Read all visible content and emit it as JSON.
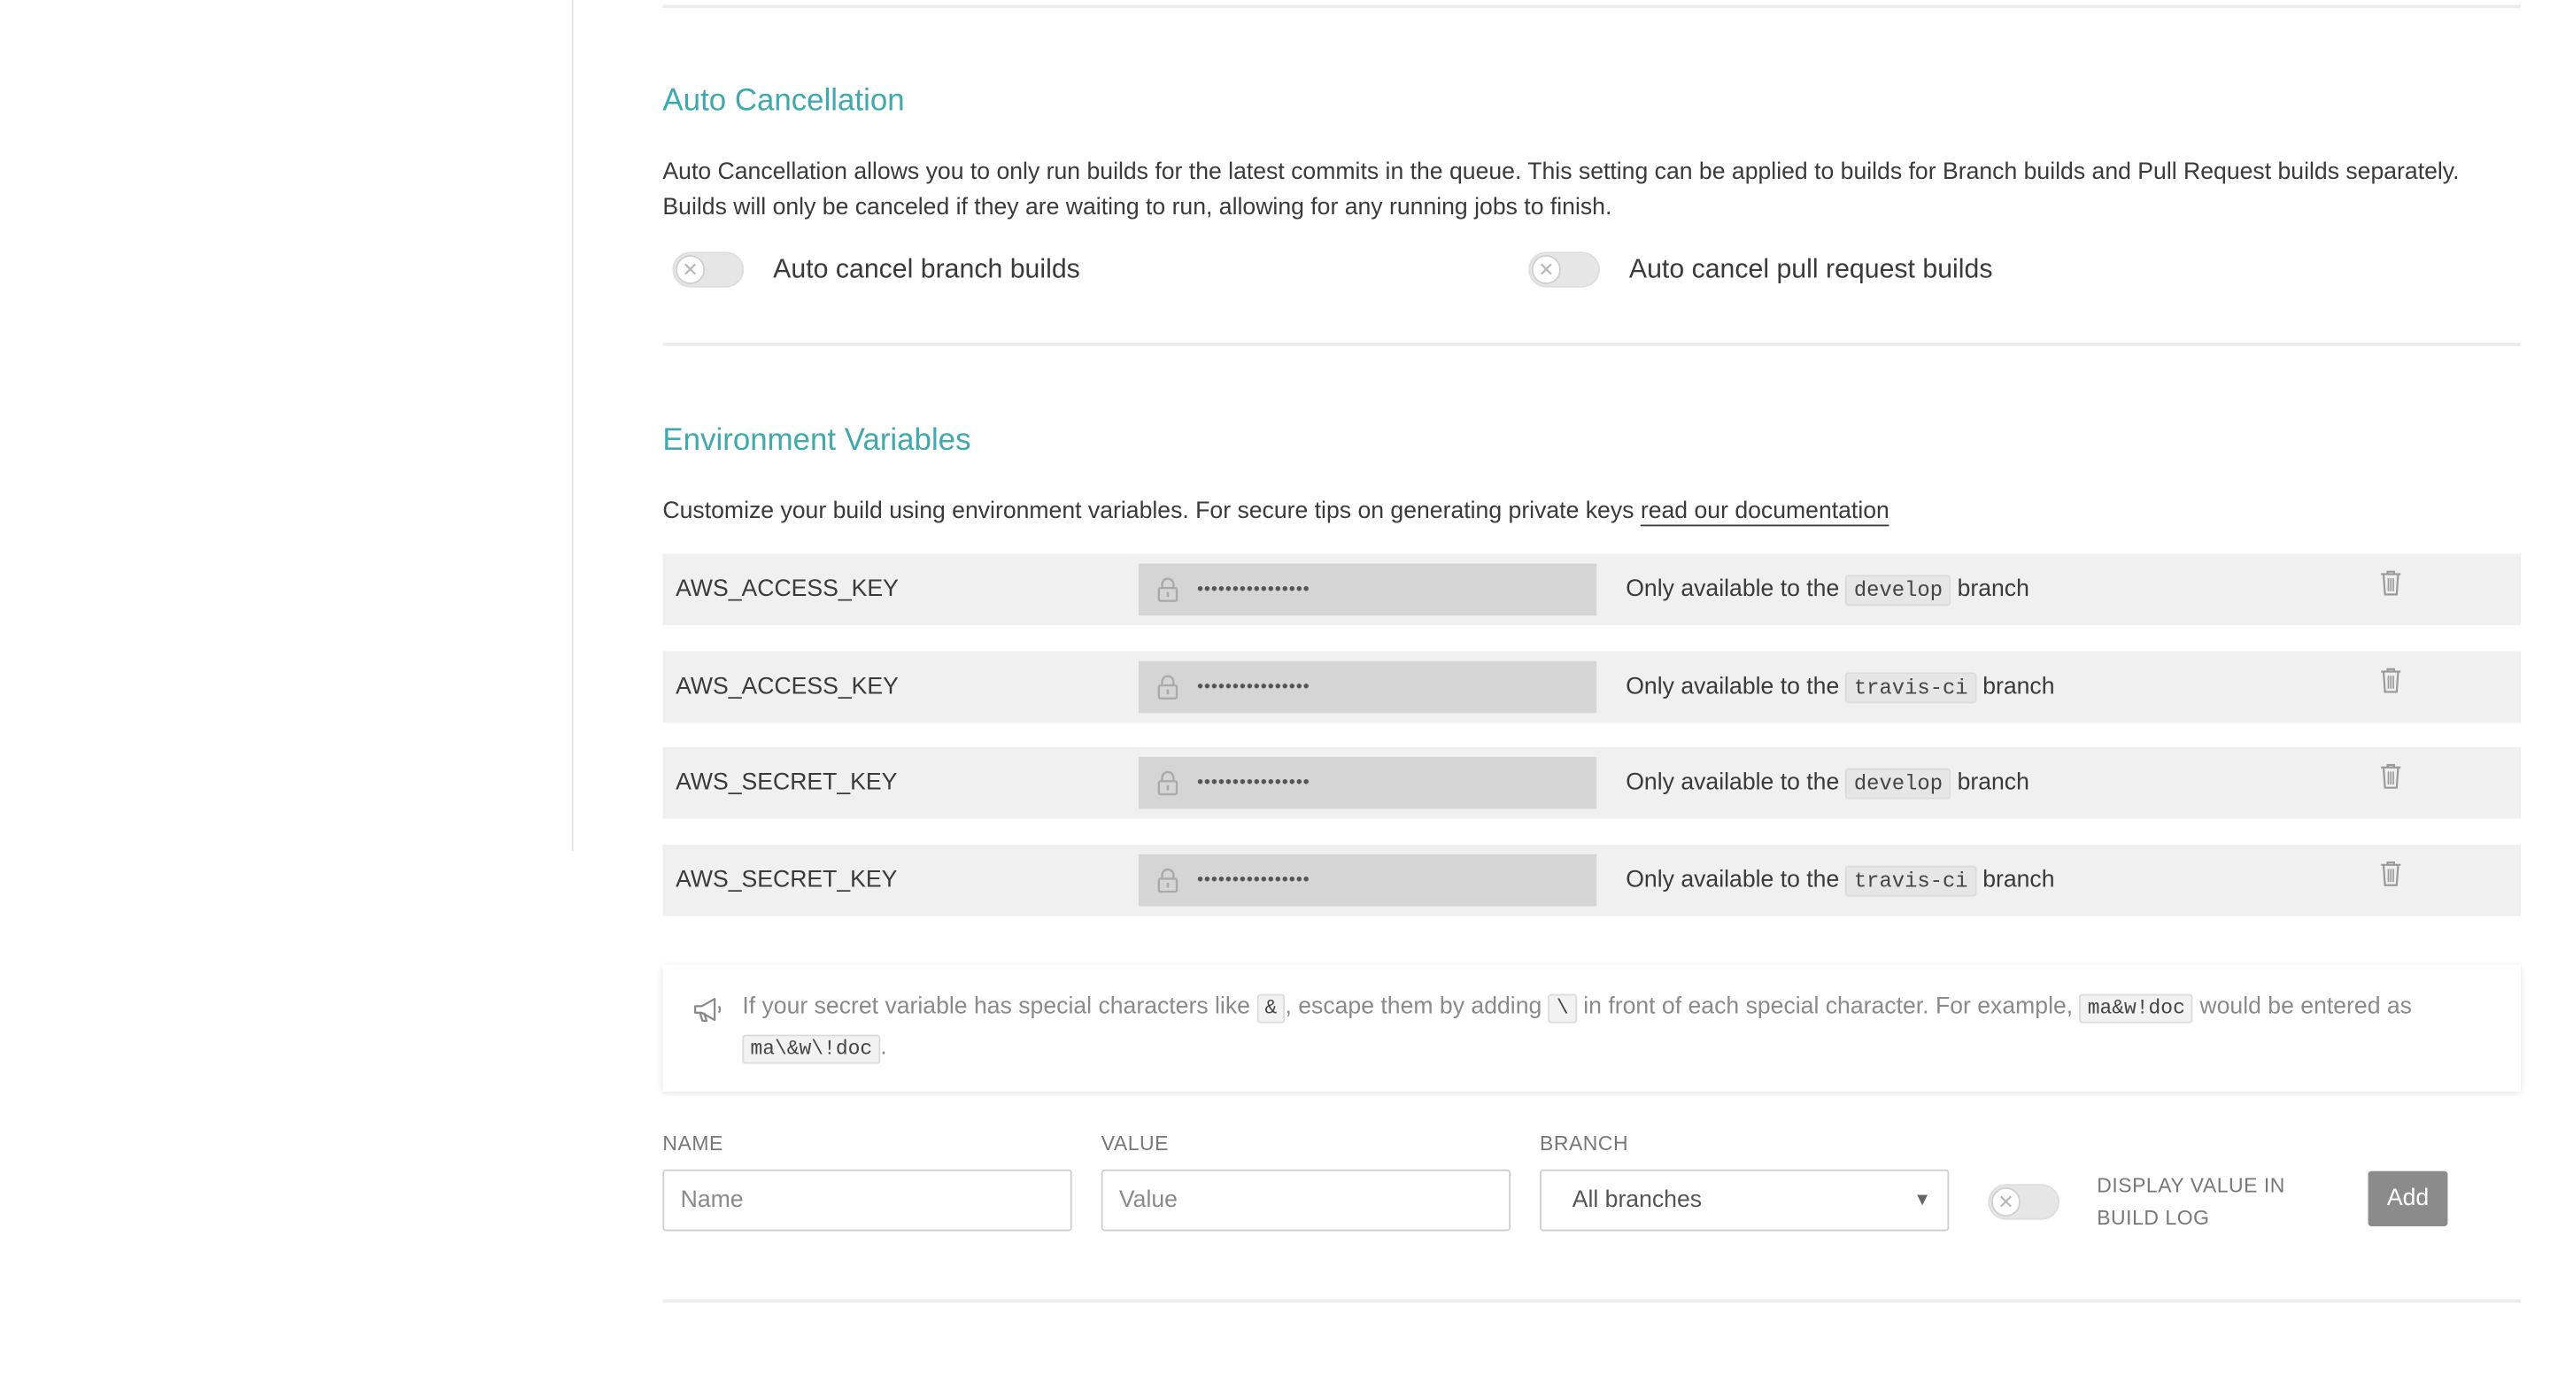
{
  "auto_cancellation": {
    "title": "Auto Cancellation",
    "description": "Auto Cancellation allows you to only run builds for the latest commits in the queue. This setting can be applied to builds for Branch builds and Pull Request builds separately. Builds will only be canceled if they are waiting to run, allowing for any running jobs to finish.",
    "branch_toggle_label": "Auto cancel branch builds",
    "branch_toggle_on": false,
    "pr_toggle_label": "Auto cancel pull request builds",
    "pr_toggle_on": false
  },
  "env_vars": {
    "title": "Environment Variables",
    "description": "Customize your build using environment variables. For secure tips on generating private keys",
    "doc_link": "read our documentation",
    "rows": [
      {
        "name": "AWS_ACCESS_KEY",
        "value": "••••••••••••••••",
        "prefix": "Only available to the",
        "branch": "develop",
        "suffix": "branch"
      },
      {
        "name": "AWS_ACCESS_KEY",
        "value": "••••••••••••••••",
        "prefix": "Only available to the",
        "branch": "travis-ci",
        "suffix": "branch"
      },
      {
        "name": "AWS_SECRET_KEY",
        "value": "••••••••••••••••",
        "prefix": "Only available to the",
        "branch": "develop",
        "suffix": "branch"
      },
      {
        "name": "AWS_SECRET_KEY",
        "value": "••••••••••••••••",
        "prefix": "Only available to the",
        "branch": "travis-ci",
        "suffix": "branch"
      }
    ]
  },
  "notice": {
    "part1": "If your secret variable has special characters like",
    "code1": "&",
    "part2": ", escape them by adding",
    "code2": "\\",
    "part3": "in front of each special character. For example,",
    "code3": "ma&w!doc",
    "part4": "would be entered as",
    "code4": "ma\\&w\\!doc",
    "part5": "."
  },
  "form": {
    "name_label": "NAME",
    "name_placeholder": "Name",
    "value_label": "VALUE",
    "value_placeholder": "Value",
    "branch_label": "BRANCH",
    "branch_selected": "All branches",
    "display_label": "DISPLAY VALUE IN BUILD LOG",
    "display_toggle_on": false,
    "add_button": "Add"
  },
  "colors": {
    "accent": "#3eaaaf",
    "row_bg": "#f0f0f0",
    "masked_bg": "#d5d5d5",
    "button_bg": "#8b8b8b"
  },
  "icons": [
    "lock-icon",
    "trash-icon",
    "megaphone-icon",
    "toggle-off-x-icon",
    "caret-down-icon"
  ]
}
